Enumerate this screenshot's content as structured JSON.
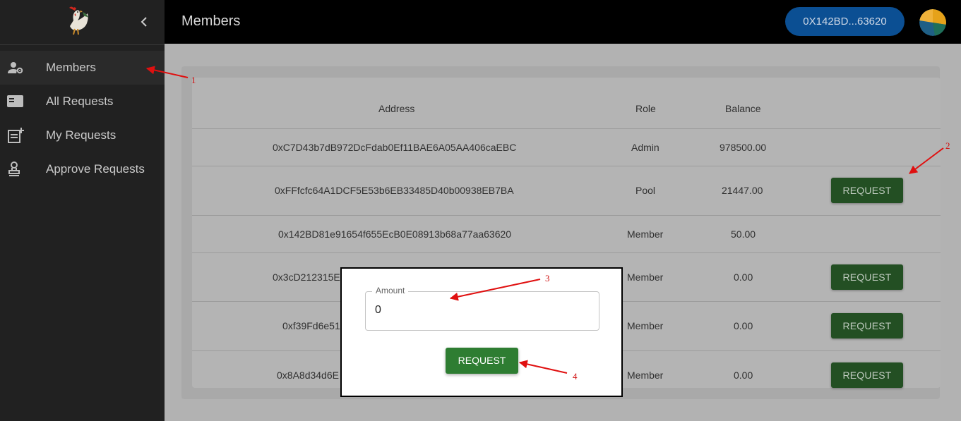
{
  "sidebar": {
    "items": [
      {
        "label": "Members",
        "icon": "members-gear-icon"
      },
      {
        "label": "All Requests",
        "icon": "folder-icon"
      },
      {
        "label": "My Requests",
        "icon": "note-add-icon"
      },
      {
        "label": "Approve Requests",
        "icon": "stamp-icon"
      }
    ]
  },
  "header": {
    "title": "Members",
    "wallet": "0X142BD...63620"
  },
  "table": {
    "columns": [
      "Address",
      "Role",
      "Balance"
    ],
    "rows": [
      {
        "address": "0xC7D43b7dB972DcFdab0Ef11BAE6A05AA406caEBC",
        "role": "Admin",
        "balance": "978500.00",
        "action": ""
      },
      {
        "address": "0xFFfcfc64A1DCF5E53b6EB33485D40b00938EB7BA",
        "role": "Pool",
        "balance": "21447.00",
        "action": "REQUEST"
      },
      {
        "address": "0x142BD81e91654f655EcB0E08913b68a77aa63620",
        "role": "Member",
        "balance": "50.00",
        "action": ""
      },
      {
        "address": "0x3cD212315ECEA3b3A7e8004B71ed4cC90BC5EC64",
        "role": "Member",
        "balance": "0.00",
        "action": "REQUEST"
      },
      {
        "address": "0xf39Fd6e51",
        "role": "Member",
        "balance": "0.00",
        "action": "REQUEST"
      },
      {
        "address": "0x8A8d34d6E",
        "role": "Member",
        "balance": "0.00",
        "action": "REQUEST"
      }
    ]
  },
  "dialog": {
    "field_label": "Amount",
    "field_value": "0",
    "button": "REQUEST"
  },
  "annotations": [
    "1",
    "2",
    "3",
    "4"
  ],
  "colors": {
    "annotation": "#e01010",
    "primary_button": "#2e7d32",
    "wallet_pill": "#0b4f93"
  }
}
